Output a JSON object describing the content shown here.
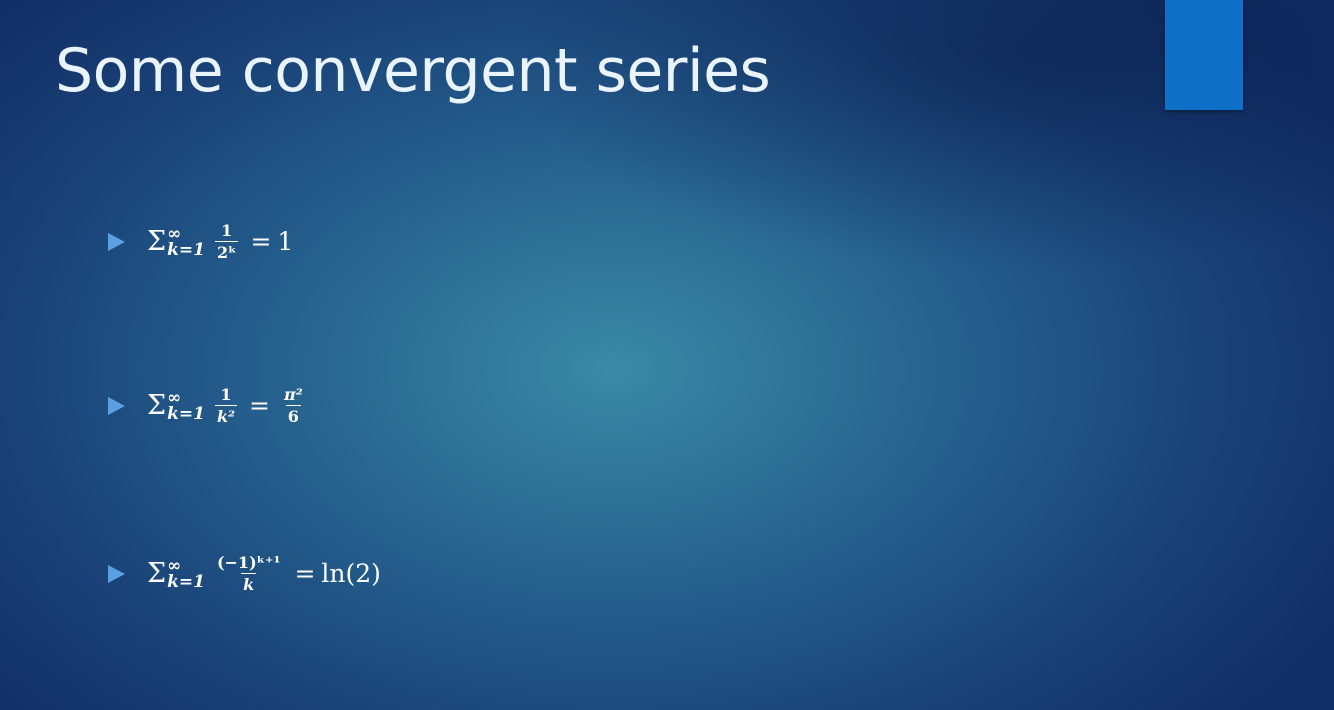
{
  "slide": {
    "title": "Some convergent series",
    "accent_color": "#0f70c8",
    "bullet_color": "#5ba0e0"
  },
  "series": [
    {
      "sigma": "Σ",
      "upper": "∞",
      "lower": "k=1",
      "numerator": "1",
      "denominator": "2ᵏ",
      "equals": "=",
      "result": "1"
    },
    {
      "sigma": "Σ",
      "upper": "∞",
      "lower": "k=1",
      "numerator": "1",
      "denominator": "k²",
      "equals": "=",
      "result_numerator": "π²",
      "result_denominator": "6"
    },
    {
      "sigma": "Σ",
      "upper": "∞",
      "lower": "k=1",
      "numerator": "(−1)ᵏ⁺¹",
      "denominator": "k",
      "equals": "=",
      "result": "ln(2)"
    }
  ]
}
